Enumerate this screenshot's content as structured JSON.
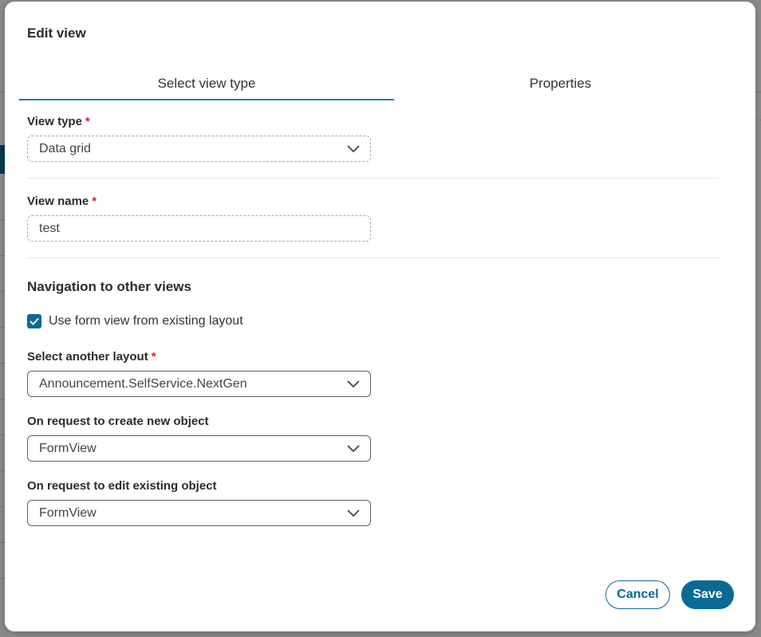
{
  "dialog": {
    "title": "Edit view"
  },
  "tabs": [
    {
      "label": "Select view type",
      "active": true
    },
    {
      "label": "Properties",
      "active": false
    }
  ],
  "view_type": {
    "label": "View type",
    "required_marker": "*",
    "value": "Data grid"
  },
  "view_name": {
    "label": "View name",
    "required_marker": "*",
    "value": "test"
  },
  "navigation": {
    "title": "Navigation to other views",
    "use_form_view": {
      "label": "Use form view from existing layout",
      "checked": true
    },
    "select_layout": {
      "label": "Select another layout",
      "required_marker": "*",
      "value": "Announcement.SelfService.NextGen"
    },
    "create_new": {
      "label": "On request to create new object",
      "value": "FormView"
    },
    "edit_existing": {
      "label": "On request to edit existing object",
      "value": "FormView"
    }
  },
  "actions": {
    "cancel_label": "Cancel",
    "save_label": "Save"
  },
  "colors": {
    "accent": "#0b6a93",
    "tab_underline": "#1a7aa6",
    "required": "#d0242b"
  }
}
